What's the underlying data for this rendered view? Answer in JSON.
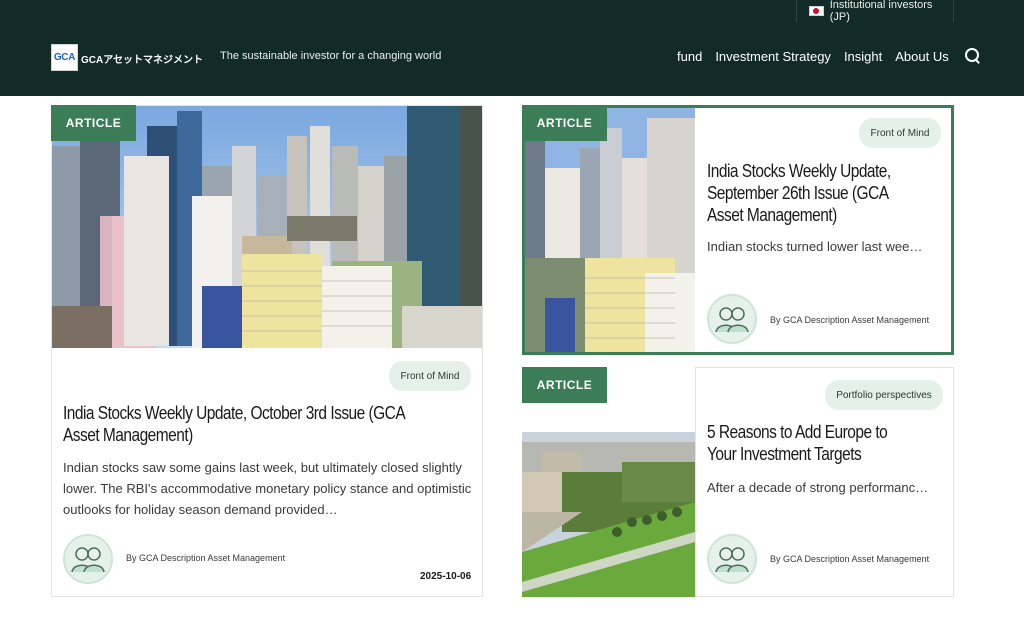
{
  "header": {
    "lang_label": "Institutional investors (JP)",
    "logo_mark": "GCA",
    "logo_text": "GCAアセットマネジメント",
    "tagline": "The sustainable investor for a changing world",
    "nav": [
      "fund",
      "Investment Strategy",
      "Insight",
      "About Us"
    ]
  },
  "cards": [
    {
      "badge": "ARTICLE",
      "tag": "Front of Mind",
      "title": "India Stocks Weekly Update, October 3rd Issue (GCA Asset Management)",
      "excerpt": "Indian stocks saw some gains last week, but ultimately closed slightly lower. The RBI's accommodative monetary policy stance and optimistic outlooks for holiday season demand provided…",
      "author": "By GCA Description Asset Management",
      "date": "2025-10-06"
    },
    {
      "badge": "ARTICLE",
      "tag": "Front of Mind",
      "title": "India Stocks Weekly Update, September 26th Issue (GCA Asset Management)",
      "excerpt": "Indian stocks turned lower last wee…",
      "author": "By GCA Description Asset Management"
    },
    {
      "badge": "ARTICLE",
      "tag": "Portfolio perspectives",
      "title": "5 Reasons to Add Europe to Your Investment Targets",
      "excerpt": "After a decade of strong performanc…",
      "author": "By GCA Description Asset Management"
    }
  ],
  "colors": {
    "header_bg": "#132b26",
    "accent_green": "#3a7d56",
    "tag_bg": "#e5f0ea"
  }
}
